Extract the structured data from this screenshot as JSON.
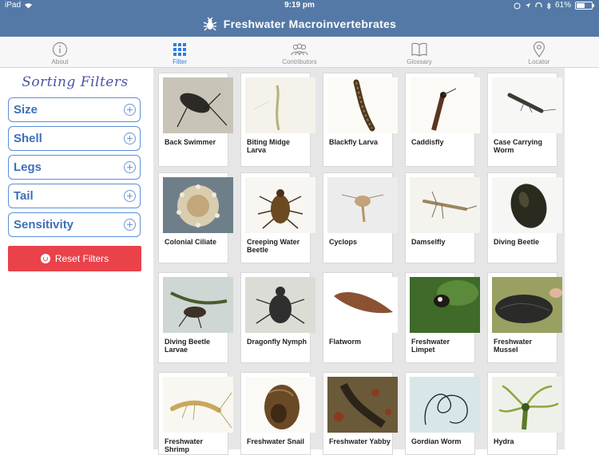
{
  "status_bar": {
    "device": "iPad",
    "time": "9:19 pm",
    "battery": "61%",
    "battery_level": 0.61
  },
  "header": {
    "title": "Freshwater Macroinvertebrates"
  },
  "tabs": [
    {
      "label": "About",
      "icon": "info-icon",
      "active": false
    },
    {
      "label": "Filter",
      "icon": "grid-icon",
      "active": true
    },
    {
      "label": "Contributors",
      "icon": "people-icon",
      "active": false
    },
    {
      "label": "Glossary",
      "icon": "book-icon",
      "active": false
    },
    {
      "label": "Locator",
      "icon": "location-pin-icon",
      "active": false
    }
  ],
  "sidebar": {
    "title": "Sorting Filters",
    "filters": [
      {
        "label": "Size"
      },
      {
        "label": "Shell"
      },
      {
        "label": "Legs"
      },
      {
        "label": "Tail"
      },
      {
        "label": "Sensitivity"
      }
    ],
    "reset_label": "Reset Filters"
  },
  "species": [
    {
      "name": "Back Swimmer"
    },
    {
      "name": "Biting Midge Larva"
    },
    {
      "name": "Blackfly Larva"
    },
    {
      "name": "Caddisfly"
    },
    {
      "name": "Case Carrying Worm"
    },
    {
      "name": "Colonial Ciliate"
    },
    {
      "name": "Creeping Water Beetle"
    },
    {
      "name": "Cyclops"
    },
    {
      "name": "Damselfly"
    },
    {
      "name": "Diving Beetle"
    },
    {
      "name": "Diving Beetle Larvae"
    },
    {
      "name": "Dragonfly Nymph"
    },
    {
      "name": "Flatworm"
    },
    {
      "name": "Freshwater Limpet"
    },
    {
      "name": "Freshwater Mussel"
    },
    {
      "name": "Freshwater Shrimp"
    },
    {
      "name": "Freshwater Snail"
    },
    {
      "name": "Freshwater Yabby"
    },
    {
      "name": "Gordian Worm"
    },
    {
      "name": "Hydra"
    }
  ],
  "colors": {
    "header": "#5479a6",
    "accent": "#2f7de1",
    "reset": "#e9424a",
    "filter_text": "#3d6fb8"
  }
}
